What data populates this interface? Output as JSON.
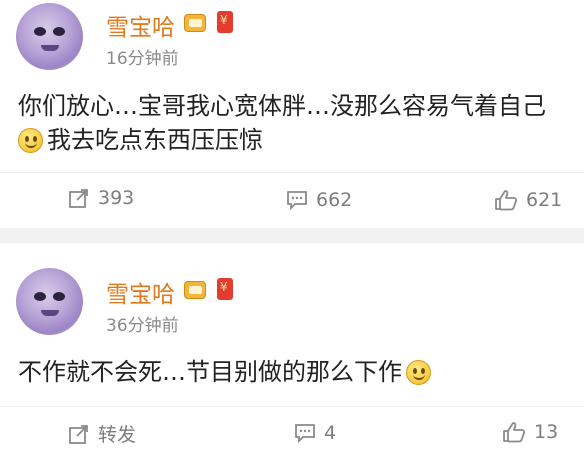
{
  "posts": [
    {
      "username": "雪宝哈",
      "time": "16分钟前",
      "text_line1": "你们放心…宝哥我心宽体胖…没那么容易气着自己",
      "text_line2": "我去吃点东西压压惊",
      "repost": "393",
      "comments": "662",
      "likes": "621"
    },
    {
      "username": "雪宝哈",
      "time": "36分钟前",
      "text_line1": "不作就不会死…节目别做的那么下作",
      "repost": "转发",
      "comments": "4",
      "likes": "13"
    }
  ],
  "icons": {
    "vip": "vip-badge-icon",
    "red_packet": "red-packet-icon",
    "smiley": "smiley-emoji-icon",
    "repost": "repost-icon",
    "comment": "comment-icon",
    "like": "thumbs-up-icon"
  },
  "colors": {
    "username": "#e07a1f",
    "time": "#8a8a8a",
    "action": "#7d7d7d"
  }
}
